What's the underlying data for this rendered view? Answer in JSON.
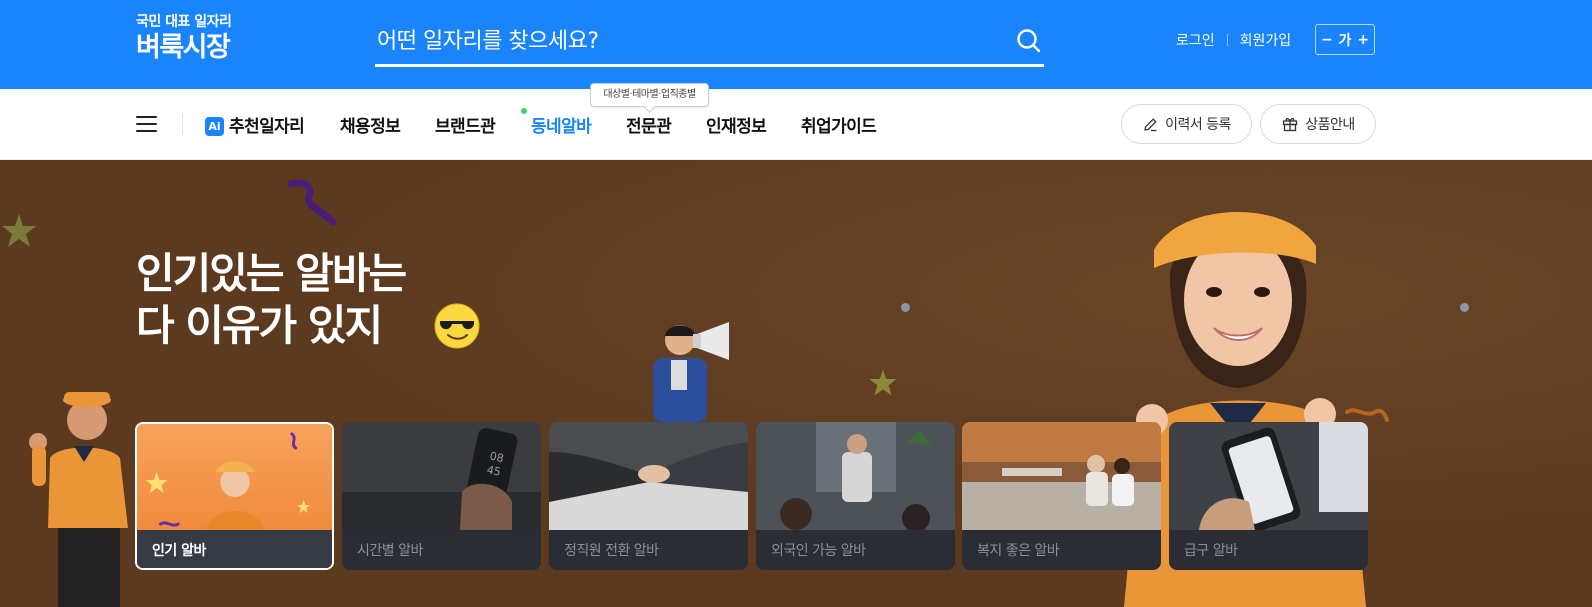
{
  "header": {
    "logo_sub": "국민 대표 일자리",
    "logo_main": "벼룩시장",
    "search_placeholder": "어떤 일자리를 찾으세요?",
    "login": "로그인",
    "signup": "회원가입",
    "font_minus": "−",
    "font_label": "가",
    "font_plus": "+"
  },
  "nav": {
    "ai_badge": "Ai",
    "items": [
      "추천일자리",
      "채용정보",
      "브랜드관",
      "동네알바",
      "전문관",
      "인재정보",
      "취업가이드"
    ],
    "active_item": "동네알바",
    "tooltip": "대상별·테마별·업직종별",
    "resume_button": "이력서 등록",
    "product_button": "상품안내"
  },
  "hero": {
    "title_line1": "인기있는 알바는",
    "title_line2": "다 이유가 있지",
    "emoji": "sunglasses-emoji"
  },
  "cards": [
    {
      "label": "인기 알바",
      "active": true
    },
    {
      "label": "시간별 알바",
      "active": false
    },
    {
      "label": "정직원 전환 알바",
      "active": false
    },
    {
      "label": "외국인 가능 알바",
      "active": false
    },
    {
      "label": "복지 좋은 알바",
      "active": false
    },
    {
      "label": "급구 알바",
      "active": false
    }
  ],
  "colors": {
    "brand_blue": "#1a84fd",
    "hero_brown": "#5b3a20",
    "nav_active": "#1a84fd"
  }
}
